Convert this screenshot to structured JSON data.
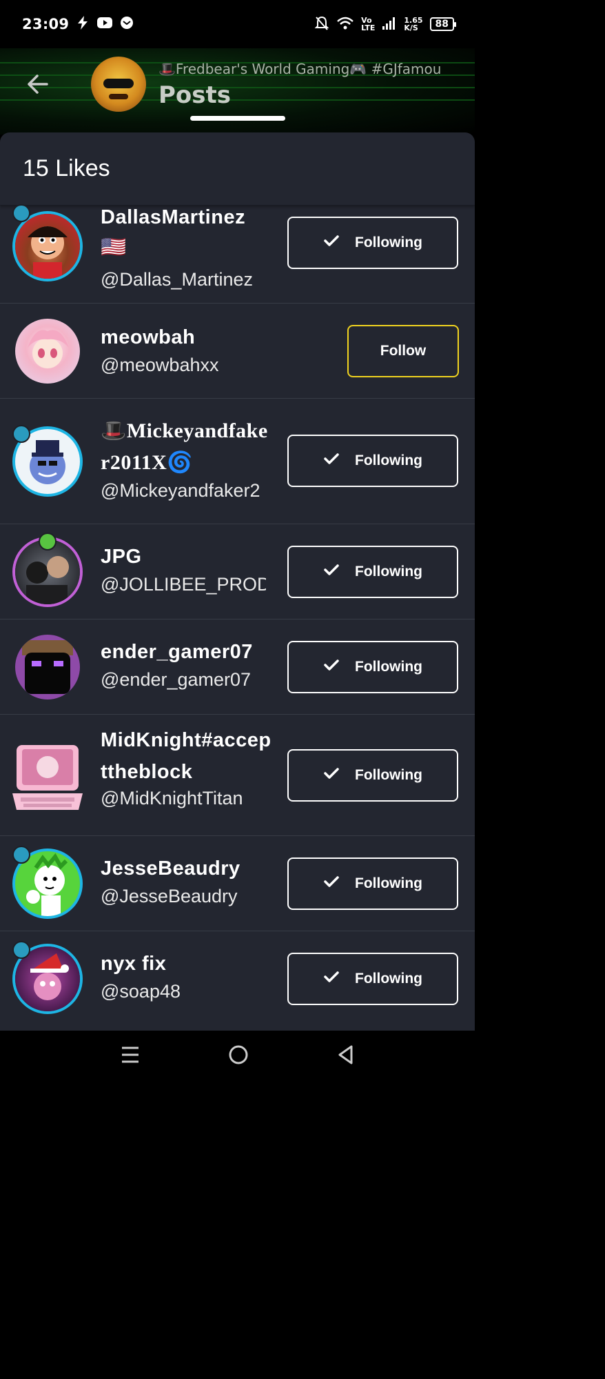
{
  "status_bar": {
    "time": "23:09",
    "net_speed_top": "1.65",
    "net_speed_bottom": "K/S",
    "volte_top": "Vo",
    "volte_bottom": "LTE",
    "battery": "88"
  },
  "header": {
    "community_title": "🎩Fredbear's World Gaming🎮 #GJfamou",
    "section": "Posts"
  },
  "likes_sheet": {
    "title": "15 Likes",
    "users": [
      {
        "name": "DallasMartinez",
        "flag": "🇺🇸",
        "handle": "@Dallas_Martinez",
        "button": "Following"
      },
      {
        "name": "meowbah",
        "handle": "@meowbahxx",
        "button": "Follow"
      },
      {
        "name": "🎩Mickeyandfaker2011X🌀",
        "handle": "@Mickeyandfaker2",
        "button": "Following"
      },
      {
        "name": "JPG",
        "handle": "@JOLLIBEE_PROD",
        "button": "Following"
      },
      {
        "name": "ender_gamer07",
        "handle": "@ender_gamer07",
        "button": "Following"
      },
      {
        "name": "MidKnight#accepttheblock",
        "handle": "@MidKnightTitan",
        "button": "Following"
      },
      {
        "name": "JesseBeaudry",
        "handle": "@JesseBeaudry",
        "button": "Following"
      },
      {
        "name": "nyx fix",
        "handle": "@soap48",
        "button": "Following"
      }
    ]
  },
  "colors": {
    "sheet_bg": "#232630",
    "follow_accent": "#f0d31f",
    "ring_blue": "#1eb5e4",
    "ring_purple": "#c160d6"
  }
}
